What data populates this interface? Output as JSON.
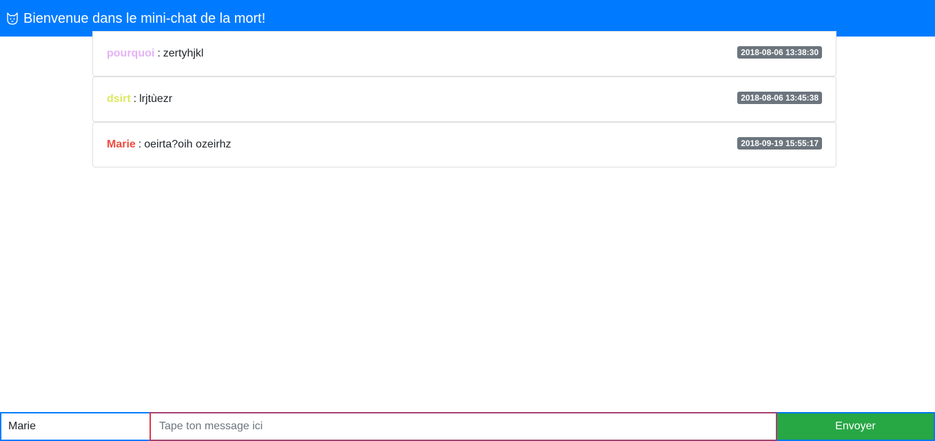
{
  "header": {
    "icon": "cat-face-icon",
    "title": "Bienvenue dans le mini-chat de la mort!"
  },
  "messages": [
    {
      "author": "pourquoi",
      "author_color": "#e4b3f4",
      "separator": ":",
      "text": "zertyhjkl",
      "timestamp": "2018-08-06 13:38:30"
    },
    {
      "author": "dsirt",
      "author_color": "#dce85f",
      "separator": ":",
      "text": "lrjtùezr",
      "timestamp": "2018-08-06 13:45:38"
    },
    {
      "author": "Marie",
      "author_color": "#ef4b3f",
      "separator": ":",
      "text": "oeirta?oih ozeirhz",
      "timestamp": "2018-09-19 15:55:17"
    }
  ],
  "composer": {
    "name_value": "Marie",
    "message_placeholder": "Tape ton message ici",
    "send_label": "Envoyer"
  },
  "colors": {
    "navbar": "#007bff",
    "send_button": "#28a745",
    "badge": "#6c757d"
  }
}
